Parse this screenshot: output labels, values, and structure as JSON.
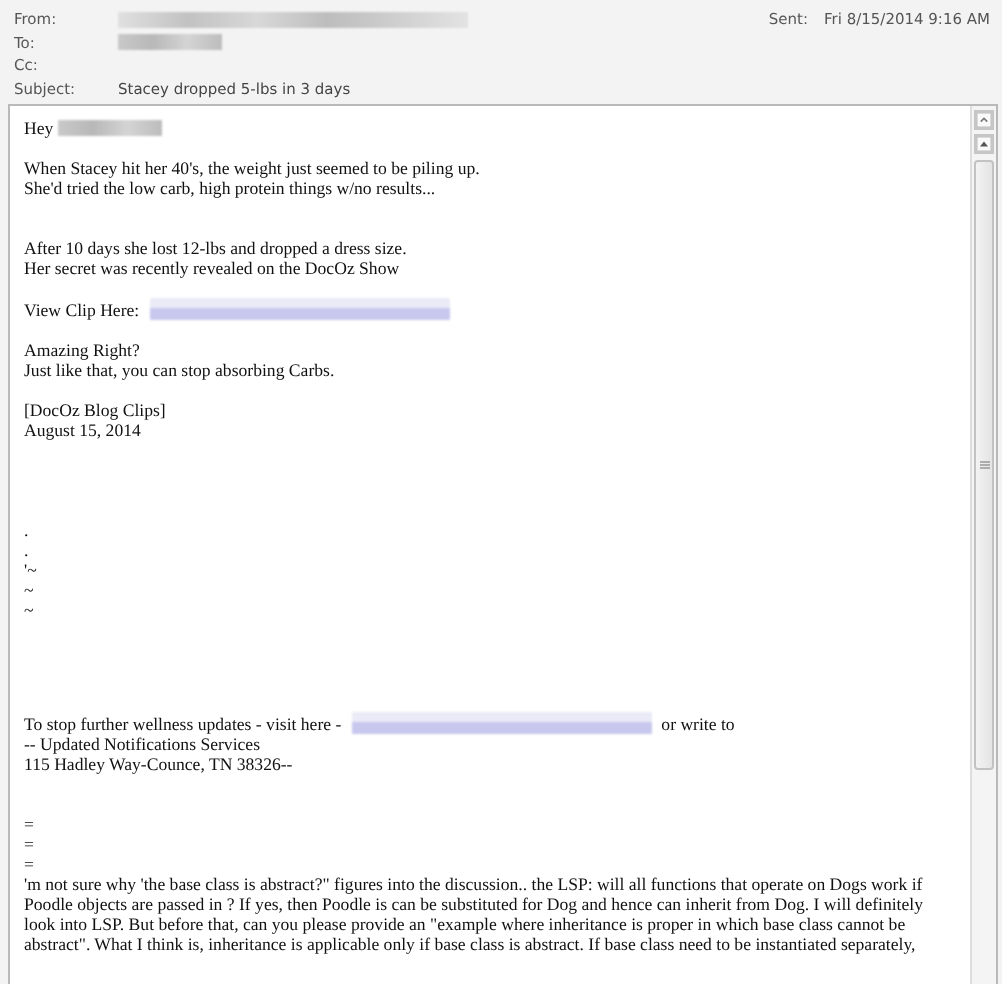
{
  "header": {
    "fields": [
      {
        "label": "From:",
        "value": {
          "kind": "redacted"
        }
      },
      {
        "label": "To:",
        "value": {
          "kind": "redacted"
        }
      },
      {
        "label": "Cc:"
      },
      {
        "label": "Subject:",
        "value": {
          "kind": "text",
          "text": "Stacey dropped 5-lbs in 3 days"
        }
      }
    ],
    "sent": {
      "label": "Sent:",
      "value": "Fri 8/15/2014 9:16 AM"
    }
  },
  "body": {
    "blocks": [
      {
        "lines": [
          [
            {
              "kind": "text",
              "text": "Hey"
            },
            {
              "kind": "redacted"
            }
          ]
        ]
      },
      {
        "lines": [
          "When Stacey hit her 40's, the weight just seemed to be piling up.",
          "She'd tried the low carb, high protein things w/no results..."
        ]
      },
      {
        "lines": [
          "After 10 days she lost 12-lbs and dropped a dress size.",
          "Her secret was recently revealed on the DocOz Show"
        ]
      },
      {
        "lines": [
          [
            {
              "kind": "text",
              "text": "View Clip Here:"
            },
            {
              "kind": "redacted-link"
            }
          ]
        ]
      },
      {
        "lines": [
          "Amazing Right?",
          "Just like that, you can stop absorbing Carbs."
        ]
      },
      {
        "lines": [
          "[DocOz Blog Clips]",
          "August 15, 2014"
        ]
      },
      {
        "lines": [
          ".",
          ".",
          "'~",
          "~",
          "~"
        ]
      },
      {
        "lines": [
          [
            {
              "kind": "text",
              "text": "To stop further wellness updates - visit here -"
            },
            {
              "kind": "redacted-link"
            },
            {
              "kind": "text",
              "text": "or write to"
            }
          ],
          "-- Updated Notifications Services",
          "115 Hadley Way-Counce, TN 38326--"
        ]
      },
      {
        "lines": [
          "=",
          "=",
          "=",
          "'m not sure why 'the base class is abstract?\" figures into the discussion.. the LSP: will all functions that operate on Dogs work if",
          "Poodle objects are passed in ? If yes, then Poodle is can be substituted for Dog and hence can inherit from Dog. I will definitely",
          "look into LSP. But before that, can you please provide an \"example where inheritance is proper in which base class cannot be",
          "abstract\". What I think is, inheritance is applicable only if base class is abstract. If base class need to be instantiated separately,"
        ]
      }
    ]
  }
}
